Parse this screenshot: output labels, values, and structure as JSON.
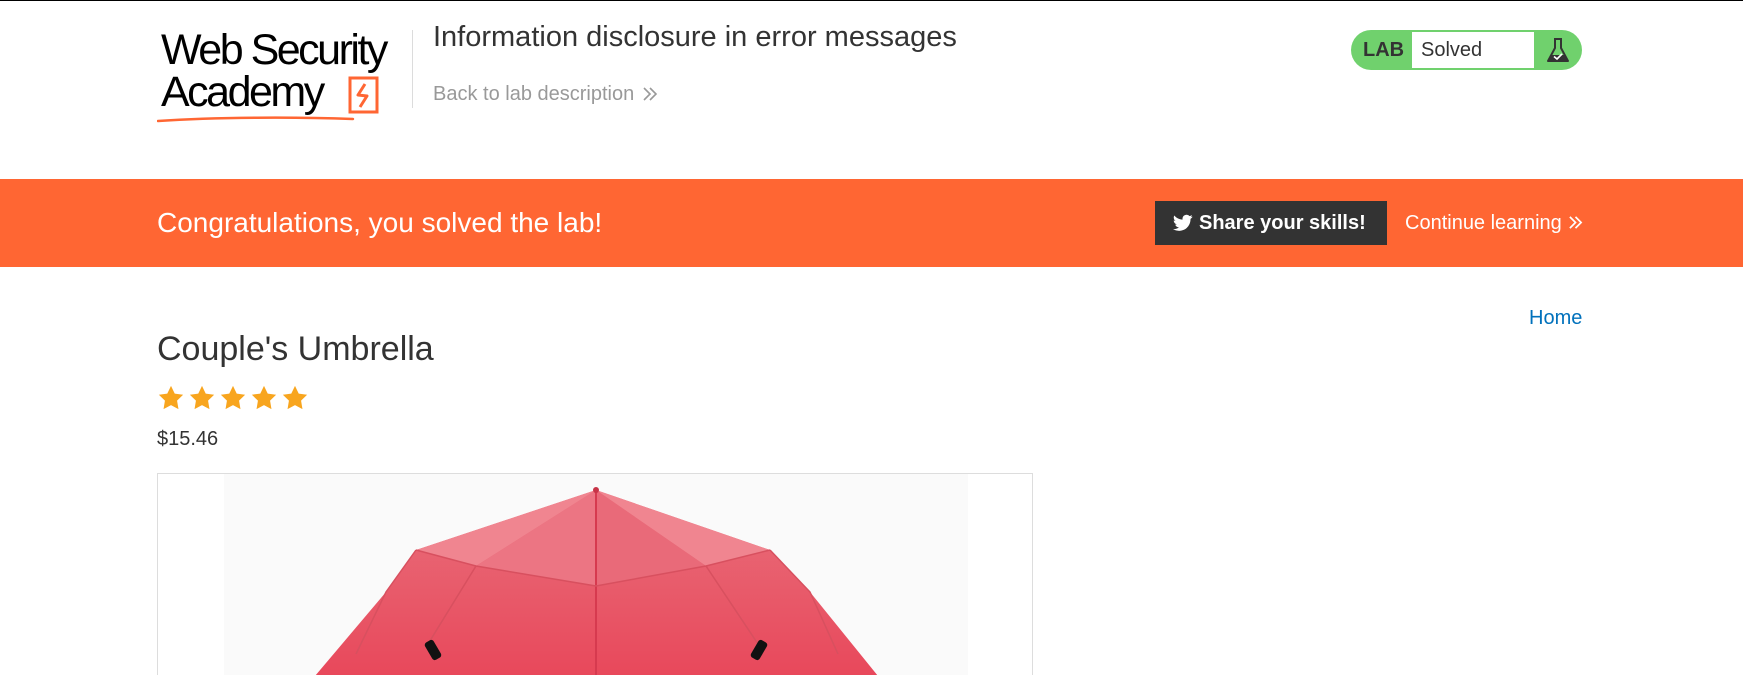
{
  "header": {
    "logo": {
      "line1": "Web Security",
      "line2": "Academy"
    },
    "lab_title": "Information disclosure in error messages",
    "back_link": "Back to lab description",
    "lab_status": {
      "label": "LAB",
      "state": "Solved",
      "icon": "flask-icon"
    }
  },
  "banner": {
    "message": "Congratulations, you solved the lab!",
    "share_button": "Share your skills!",
    "share_icon": "twitter-icon",
    "continue_link": "Continue learning"
  },
  "nav": {
    "home": "Home"
  },
  "product": {
    "title": "Couple's Umbrella",
    "rating": 5,
    "rating_max": 5,
    "price": "$15.46",
    "image_icon": "red-umbrella-image"
  },
  "colors": {
    "brand_orange": "#ff6633",
    "lab_green": "#70d16d",
    "link_blue": "#0071bc",
    "star_gold": "#f8a51e",
    "dark": "#333333"
  }
}
